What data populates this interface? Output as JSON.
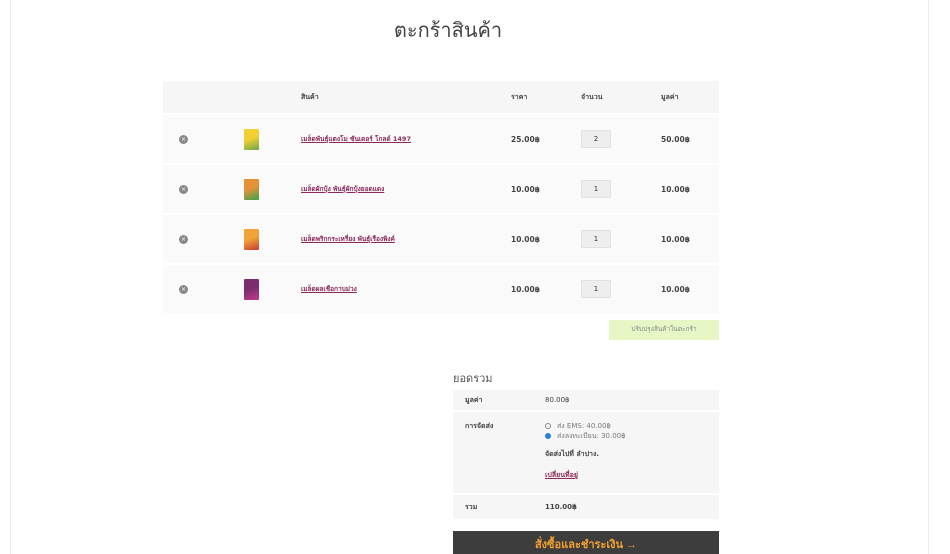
{
  "page": {
    "title": "ตะกร้าสินค้า"
  },
  "cart": {
    "headers": {
      "product": "สินค้า",
      "price": "ราคา",
      "quantity": "จำนวน",
      "subtotal": "มูลค่า"
    },
    "remove_icon": "×",
    "items": [
      {
        "name": "เมล็ดพันธุ์แตงโม ซันเดอร์ โกลด์ 1497",
        "price": "25.00฿",
        "qty": "2",
        "subtotal": "50.00฿",
        "thumb_colors": [
          "#f2d033",
          "#6aa84f"
        ]
      },
      {
        "name": "เมล็ดผักบุ้ง พันธุ์ผักบุ้งยอดแดง",
        "price": "10.00฿",
        "qty": "1",
        "subtotal": "10.00฿",
        "thumb_colors": [
          "#e69138",
          "#38a34a"
        ]
      },
      {
        "name": "เมล็ดพริกกระเหรี่ยง พันธุ์เรืองพิงค์",
        "price": "10.00฿",
        "qty": "1",
        "subtotal": "10.00฿",
        "thumb_colors": [
          "#f1a33a",
          "#cc3b2f"
        ]
      },
      {
        "name": "เมล็ดผลเชือกาบม่วง",
        "price": "10.00฿",
        "qty": "1",
        "subtotal": "10.00฿",
        "thumb_colors": [
          "#7a2c6e",
          "#c23a8a"
        ]
      }
    ],
    "update_button": "ปรับปรุงสินค้าในตะกร้า"
  },
  "totals": {
    "title": "ยอดรวม",
    "subtotal_label": "มูลค่า",
    "subtotal_value": "80.00฿",
    "shipping_label": "การจัดส่ง",
    "shipping_options": [
      {
        "label": "ส่ง EMS: 40.00฿",
        "selected": false
      },
      {
        "label": "ส่งลงทะเบียน: 30.00฿",
        "selected": true
      }
    ],
    "ship_to": "จัดส่งไปที่ ลำปาง.",
    "change_address": "เปลี่ยนที่อยู่",
    "total_label": "รวม",
    "total_value": "110.00฿"
  },
  "checkout": {
    "label": "สั่งซื้อและชำระเงิน →"
  },
  "colors": {
    "link": "#8b2a5a",
    "update_bg": "#e6f7c5",
    "checkout_bg": "#3d3d3d",
    "checkout_text": "#f0a030",
    "radio_on": "#2a7fd9"
  }
}
